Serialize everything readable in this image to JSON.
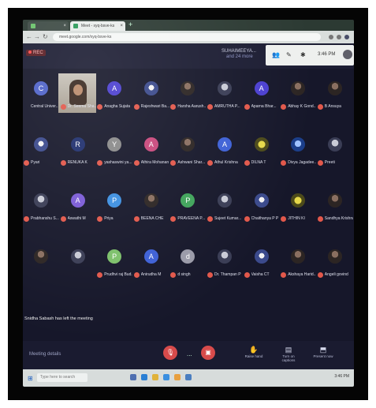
{
  "browser": {
    "tabs": [
      {
        "label": "",
        "active": false
      },
      {
        "label": "Meet - xyq-bsve-ks",
        "active": true
      }
    ],
    "url": "meet.google.com/xyq-bsve-ks"
  },
  "meet": {
    "rec_label": "REC",
    "pinned_name": "SUHAIMEEYA...",
    "pinned_more": "and 24 more",
    "time": "3:46 PM",
    "meeting_details": "Meeting details",
    "leave_note": "Snidha Sabash has left the meeting"
  },
  "participants": [
    {
      "name": "Central Univer...",
      "initial": "C",
      "color": "#4f63c9",
      "kind": "initial",
      "muted": false
    },
    {
      "name": "Dr. Seema Sha...",
      "initial": "",
      "color": "#000000",
      "kind": "video",
      "muted": true
    },
    {
      "name": "Anagha Sujata",
      "initial": "A",
      "color": "#4b3fd0",
      "kind": "initial",
      "muted": true
    },
    {
      "name": "Rajeshwari Ba...",
      "initial": "",
      "color": "#3b4a8c",
      "kind": "logo",
      "muted": true
    },
    {
      "name": "Harsha Aarush...",
      "initial": "",
      "color": "#2c2523",
      "kind": "dark",
      "muted": true
    },
    {
      "name": "AMRUTHA P...",
      "initial": "",
      "color": "#3a3d55",
      "kind": "photo",
      "muted": true
    },
    {
      "name": "Aparna Bhar...",
      "initial": "A",
      "color": "#4b3fd0",
      "kind": "initial",
      "muted": true
    },
    {
      "name": "Abhay K Gond...",
      "initial": "",
      "color": "#2c2523",
      "kind": "dark",
      "muted": true
    },
    {
      "name": "B Ansuya",
      "initial": "",
      "color": "#2c2523",
      "kind": "dark",
      "muted": true
    },
    {
      "name": "Pyari",
      "initial": "",
      "color": "#3b4a8c",
      "kind": "logo",
      "muted": true
    },
    {
      "name": "RENUKA K",
      "initial": "R",
      "color": "#1f2f6e",
      "kind": "initial",
      "muted": true
    },
    {
      "name": "yashaswini ya...",
      "initial": "Y",
      "color": "#8a8a8a",
      "kind": "initial",
      "muted": true
    },
    {
      "name": "Athira Mohanan",
      "initial": "A",
      "color": "#c9487c",
      "kind": "initial",
      "muted": true
    },
    {
      "name": "Ashwani Shar...",
      "initial": "",
      "color": "#2c2523",
      "kind": "dark",
      "muted": true
    },
    {
      "name": "Athul Krishna",
      "initial": "A",
      "color": "#3d60d6",
      "kind": "initial",
      "muted": true
    },
    {
      "name": "DILNA T",
      "initial": "",
      "color": "#4c4a1a",
      "kind": "yellow",
      "muted": true
    },
    {
      "name": "Divya Jagadee...",
      "initial": "",
      "color": "#1b3e8a",
      "kind": "blueimg",
      "muted": true
    },
    {
      "name": "Preeti",
      "initial": "",
      "color": "#3a3d55",
      "kind": "photo",
      "muted": true
    },
    {
      "name": "Prabhanshu S...",
      "initial": "",
      "color": "#3a3d55",
      "kind": "photo",
      "muted": true
    },
    {
      "name": "Aswathi M",
      "initial": "A",
      "color": "#7b5bd6",
      "kind": "initial",
      "muted": true
    },
    {
      "name": "Priya",
      "initial": "P",
      "color": "#3d8fe0",
      "kind": "initial",
      "muted": true
    },
    {
      "name": "BEENA CHE",
      "initial": "",
      "color": "#2c2523",
      "kind": "dark",
      "muted": true
    },
    {
      "name": "PRAVEENA P...",
      "initial": "P",
      "color": "#3fa45a",
      "kind": "initial",
      "muted": true
    },
    {
      "name": "Sujeet Kumar...",
      "initial": "",
      "color": "#3a3d55",
      "kind": "photo",
      "muted": true
    },
    {
      "name": "Chaithanya P P",
      "initial": "",
      "color": "#3b4a8c",
      "kind": "logo",
      "muted": true
    },
    {
      "name": "JITHIN KI",
      "initial": "",
      "color": "#4c4a1a",
      "kind": "yellow",
      "muted": true
    },
    {
      "name": "Sandhya Krishna",
      "initial": "",
      "color": "#2c2523",
      "kind": "dark",
      "muted": true
    },
    {
      "name": "",
      "initial": "",
      "color": "#2c2523",
      "kind": "dark",
      "muted": false
    },
    {
      "name": "",
      "initial": "",
      "color": "#3a3d55",
      "kind": "photo",
      "muted": false
    },
    {
      "name": "Prudhvi raj Bud...",
      "initial": "P",
      "color": "#7cc06a",
      "kind": "initial",
      "muted": true
    },
    {
      "name": "Anirudha M",
      "initial": "A",
      "color": "#3d60d6",
      "kind": "initial",
      "muted": true
    },
    {
      "name": "d singh",
      "initial": "d",
      "color": "#9a9aa8",
      "kind": "initial",
      "muted": true
    },
    {
      "name": "Dr. Thampan P",
      "initial": "",
      "color": "#3a3d55",
      "kind": "photo",
      "muted": true
    },
    {
      "name": "Vaisha CT",
      "initial": "",
      "color": "#3b4a8c",
      "kind": "logo",
      "muted": true
    },
    {
      "name": "Akshaya Harid...",
      "initial": "",
      "color": "#2c2523",
      "kind": "dark",
      "muted": true
    },
    {
      "name": "Angeli govind",
      "initial": "",
      "color": "#2c2523",
      "kind": "dark",
      "muted": true
    }
  ],
  "controls": {
    "mic_icon": "mic-off-icon",
    "cam_icon": "camera-off-icon",
    "more_label": "...",
    "right_buttons": [
      {
        "label": "Raise hand",
        "icon": "hand-icon"
      },
      {
        "label": "Turn on captions",
        "icon": "cc-icon"
      },
      {
        "label": "Present now",
        "icon": "present-icon"
      }
    ]
  },
  "taskbar": {
    "search_placeholder": "Type here to search",
    "tray_time": "3:46 PM"
  }
}
